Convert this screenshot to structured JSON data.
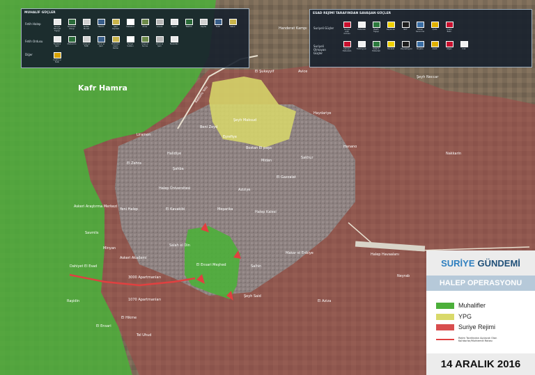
{
  "labels": {
    "kafr_hamra": "Kafr Hamra",
    "handerat": "Handerat Kampı",
    "el_sukayyif": "El Şukayyif",
    "avice": "Avice",
    "seyh_neccar": "Şeyh Neccar",
    "kastello": "Kastello Yolu",
    "seyh_maksud": "Şeyh Maksud",
    "haydariye": "Haydariye",
    "beni_zeyd": "Beni Zeyd",
    "liramon": "Liramon",
    "eskiriye": "Eşrefiye",
    "bostan_el_pasa": "Bostan El paşa",
    "hanano": "Hanano",
    "halidiye": "Halidiye",
    "midan": "Midan",
    "sakhur": "Sakhur",
    "nakkarin": "Nakkarin",
    "el_zehra": "El Zehra",
    "sahba": "Şahba",
    "el_gazzalat": "El Gazzalat",
    "halep_uni": "Halep Üniversitesi",
    "aziziye": "Aziziye",
    "askeri_arastirma": "Askeri Araştırma Merkezi",
    "yeni_halep": "Yeni Halep",
    "el_kavakibi": "El Kavakibi",
    "mesarika": "Meşarika",
    "halep_kalesi": "Halep Kalesi",
    "savmlis": "Savmlis",
    "minyan": "Minyan",
    "salah_el_din": "Salah el Din",
    "makar_el_enbiye": "Makar el Enbiye",
    "halep_havaalani": "Halep Havaalanı",
    "dahiyet_el_esad": "Dahiyet El Esad",
    "askeri_akademi": "Askeri Akademi",
    "el_ensari_meshed": "El Ensari Meşhed",
    "salhin": "Salhin",
    "neyrab": "Neyrab",
    "3000_apartman": "3000 Apartmanları",
    "rasidin": "Raşidin",
    "1070_apartman": "1070 Apartmanları",
    "seyh_said": "Şeyh Said",
    "el_aziza": "El Aziza",
    "el_hikme": "El Hikme",
    "el_ensari": "El Ensari",
    "tel_uhud": "Tel Uhud"
  },
  "opposition_panel": {
    "title": "MUHALİF GÜÇLER",
    "groups": [
      "Fetih Halep",
      "Fetih Ordusu",
      "Diğer"
    ],
    "row1": [
      "Suriye Hürriyet Tugayı",
      "Nureddin Zengi",
      "Sultan Murad",
      "Hazzm",
      "Şam Cephesi",
      "Fastakim",
      "Ahrar",
      "Levant",
      "Ajnad",
      "Tawhid",
      "Cephe",
      "Fetih",
      "Sakur"
    ],
    "row2": [
      "Feylakul Şam",
      "Muhacirin",
      "Ceyş el Fetih",
      "Ahrar el Şam",
      "Türkistan Islam Partisi",
      "Suriye Sultanı",
      "Ceyş el Sunna",
      "Ahrar el Şam",
      "Nureddin"
    ],
    "row3": [
      "Cephe el Fetih"
    ]
  },
  "regime_panel": {
    "title": "ESAD REJİMİ TARAFINDAN SAVAŞAN GÜÇLER",
    "groups": [
      "Suriyeli Güçler",
      "Suriyeli Olmayan Güçler"
    ],
    "row1": [
      "Suriye Arap Ordusu",
      "Hizbullah",
      "Baath Tugayı",
      "Kaplanlar",
      "NDF",
      "Ulusal Savunma",
      "Quds",
      "Imam Bakır"
    ],
    "row2": [
      "Lübnan Hizbullahı",
      "Fatimiyyun",
      "Kata'ib Hizbullah",
      "Harakat",
      "Zeynebiyyun",
      "Nujaba",
      "Asaib",
      "Afgan",
      "Irak"
    ]
  },
  "legend": {
    "brand_a": "SURİYE",
    "brand_b": "GÜNDEMİ",
    "operation": "HALEP OPERASYONU",
    "opposition": "Muhalifler",
    "ypg": "YPG",
    "regime": "Suriye Rejimi",
    "route": "Rejim Tarafından Açılacak Olan Koridorlar/Muhtemel Rotası",
    "date": "14 ARALIK 2016"
  },
  "colors": {
    "opposition": "#4caf3a",
    "ypg": "#d9d96a",
    "regime": "#d84e4e",
    "route": "#e04040"
  }
}
